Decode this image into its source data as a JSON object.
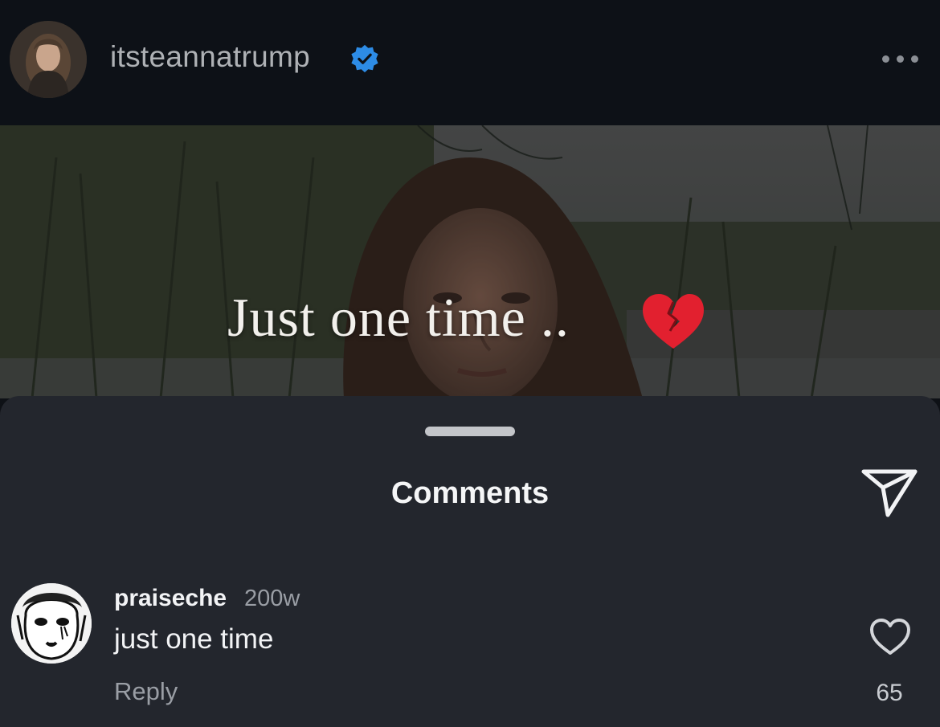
{
  "post": {
    "username": "itsteannatrump",
    "verified": true,
    "caption": "Just one time ..",
    "caption_emoji": "broken-heart-icon"
  },
  "comments_sheet": {
    "title": "Comments",
    "share_icon": "send-icon"
  },
  "comments": [
    {
      "username": "praiseche",
      "age": "200w",
      "text": "just one time",
      "reply_label": "Reply",
      "like_count": "65"
    }
  ],
  "colors": {
    "header_bg": "#0d1117",
    "sheet_bg": "#23262d",
    "verified_blue": "#2d8ce6",
    "broken_heart_red": "#e2202f"
  }
}
